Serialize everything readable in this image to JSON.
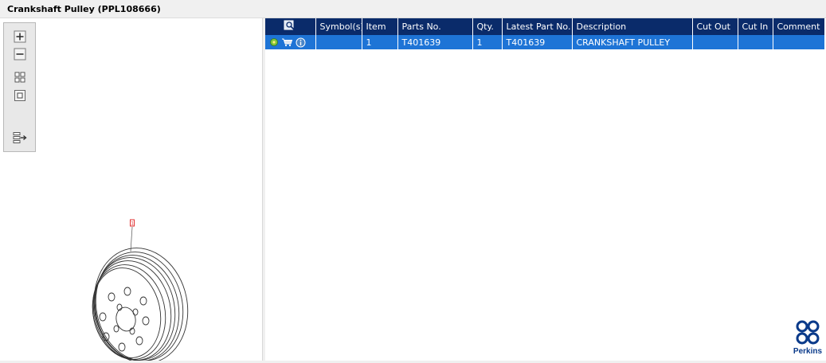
{
  "window": {
    "title": "Crankshaft Pulley (PPL108666)"
  },
  "toolbar": {
    "zoom_in_icon": "plus-icon",
    "zoom_out_icon": "minus-icon",
    "fit_icon": "grid-icon",
    "single_icon": "square-icon",
    "export_icon": "export-icon"
  },
  "drawing": {
    "callout": "1"
  },
  "table": {
    "headers": [
      "",
      "Symbol(s)",
      "Item",
      "Parts No.",
      "Qty.",
      "Latest Part No.",
      "Description",
      "Cut Out",
      "Cut In",
      "Comment"
    ],
    "rows": [
      {
        "symbols": "",
        "item": "1",
        "part_no": "T401639",
        "qty": "1",
        "latest_part_no": "T401639",
        "description": "CRANKSHAFT PULLEY",
        "cut_out": "",
        "cut_in": "",
        "comment": ""
      }
    ]
  },
  "logo": {
    "text": "Perkins"
  },
  "colors": {
    "header_bg": "#0a2b6a",
    "selected_row": "#1e74d6"
  }
}
